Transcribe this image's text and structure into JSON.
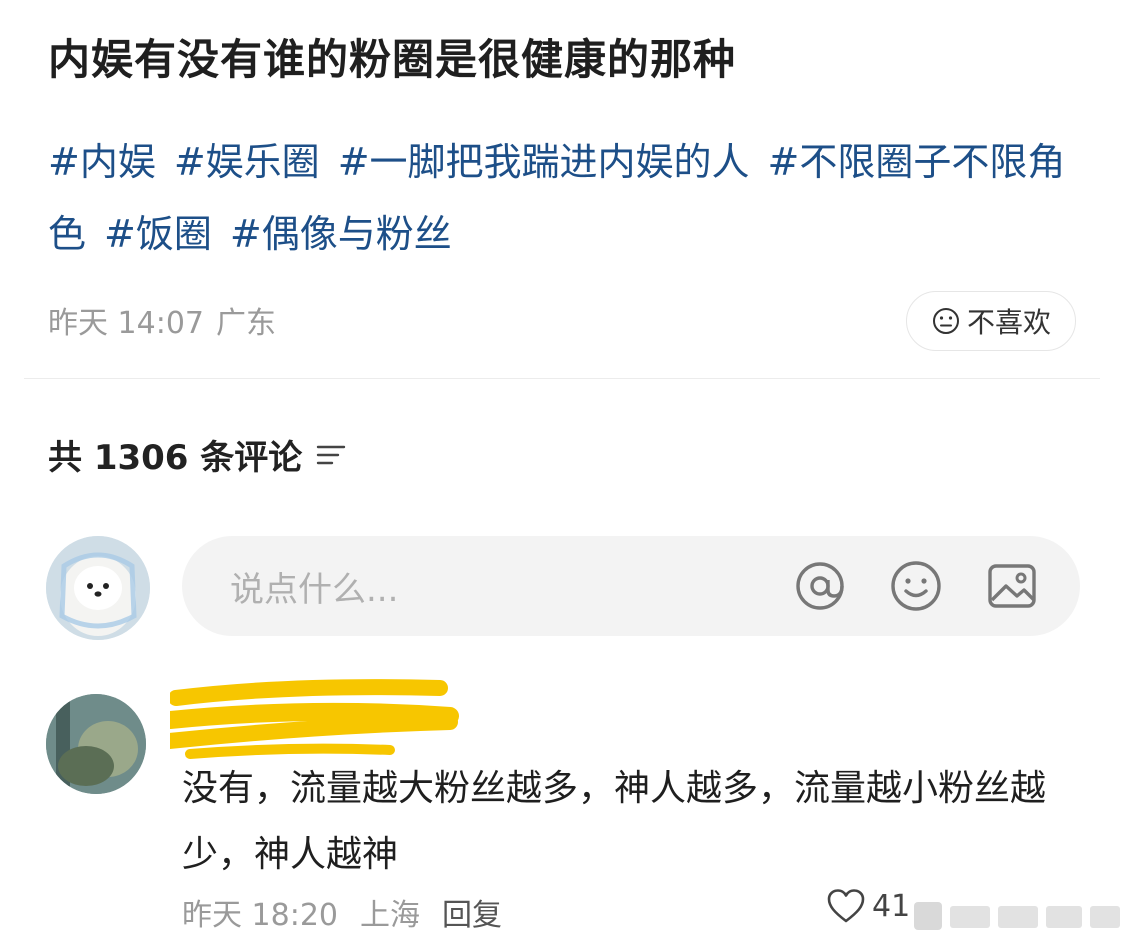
{
  "post": {
    "title": "内娱有没有谁的粉圈是很健康的那种",
    "tags": [
      "#内娱",
      "#娱乐圈",
      "#一脚把我踹进内娱的人",
      "#不限圈子不限角色",
      "#饭圈",
      "#偶像与粉丝"
    ],
    "date": "昨天 14:07",
    "location": "广东",
    "dislike_label": "不喜欢"
  },
  "comments_header": {
    "label": "共 1306 条评论"
  },
  "comment_input": {
    "placeholder": "说点什么...",
    "icons": [
      "at-icon",
      "emoji-icon",
      "image-icon"
    ]
  },
  "comments": [
    {
      "text": "没有，流量越大粉丝越多，神人越多，流量越小粉丝越少，神人越神",
      "time": "昨天 18:20",
      "location": "上海",
      "reply_label": "回复",
      "likes": "41"
    }
  ],
  "colors": {
    "tag": "#1d4f88",
    "meta": "#9a9a9a",
    "input_bg": "#f3f3f3",
    "redaction": "#f7c600"
  }
}
